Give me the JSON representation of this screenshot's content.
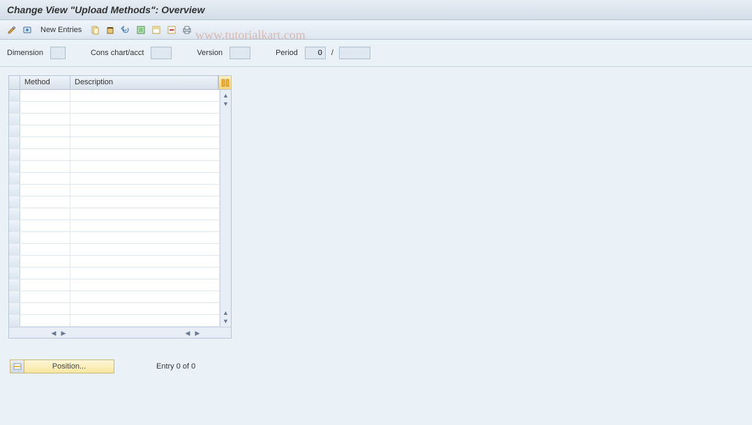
{
  "title": "Change View \"Upload Methods\": Overview",
  "watermark": "www.tutorialkart.com",
  "toolbar": {
    "new_entries_label": "New Entries"
  },
  "filters": {
    "dimension_label": "Dimension",
    "dimension_value": "",
    "cons_chart_label": "Cons chart/acct",
    "cons_chart_value": "",
    "version_label": "Version",
    "version_value": "",
    "period_label": "Period",
    "period_value": "0",
    "period_sep": "/",
    "year_value": ""
  },
  "grid": {
    "columns": {
      "method": "Method",
      "description": "Description"
    },
    "rows": [
      {
        "method": "",
        "description": ""
      },
      {
        "method": "",
        "description": ""
      },
      {
        "method": "",
        "description": ""
      },
      {
        "method": "",
        "description": ""
      },
      {
        "method": "",
        "description": ""
      },
      {
        "method": "",
        "description": ""
      },
      {
        "method": "",
        "description": ""
      },
      {
        "method": "",
        "description": ""
      },
      {
        "method": "",
        "description": ""
      },
      {
        "method": "",
        "description": ""
      },
      {
        "method": "",
        "description": ""
      },
      {
        "method": "",
        "description": ""
      },
      {
        "method": "",
        "description": ""
      },
      {
        "method": "",
        "description": ""
      },
      {
        "method": "",
        "description": ""
      },
      {
        "method": "",
        "description": ""
      },
      {
        "method": "",
        "description": ""
      },
      {
        "method": "",
        "description": ""
      },
      {
        "method": "",
        "description": ""
      },
      {
        "method": "",
        "description": ""
      }
    ]
  },
  "footer": {
    "position_label": "Position...",
    "entry_text": "Entry 0 of 0"
  }
}
